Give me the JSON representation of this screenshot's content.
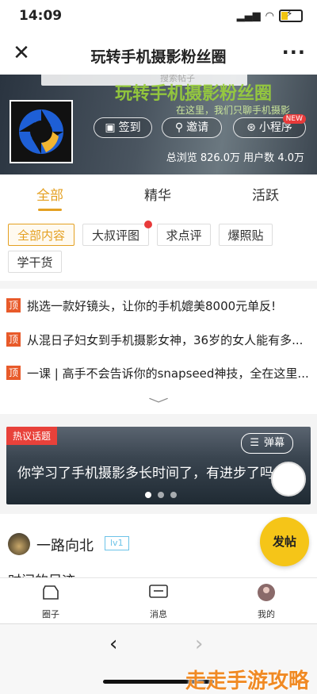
{
  "status_bar": {
    "time": "14:09"
  },
  "nav": {
    "title": "玩转手机摄影粉丝圈"
  },
  "banner": {
    "big_title": "玩转手机摄影粉丝圈",
    "slogan": "在这里，我们只聊手机摄影",
    "search_placeholder": "搜索帖子",
    "buttons": {
      "checkin": "签到",
      "invite": "邀请",
      "miniprogram": "小程序"
    },
    "new_badge": "NEW",
    "stats": "总浏览 826.0万  用户数 4.0万"
  },
  "tabs": [
    "全部",
    "精华",
    "活跃"
  ],
  "categories": [
    "全部内容",
    "大叔评图",
    "求点评",
    "爆照贴",
    "学干货"
  ],
  "pinned": {
    "tag": "顶",
    "items": [
      "挑选一款好镜头，让你的手机媲美8000元单反!",
      "从混日子妇女到手机摄影女神，36岁的女人能有多...",
      "一课 | 高手不会告诉你的snapseed神技，全在这里..."
    ]
  },
  "hot_topic": {
    "tag": "热议话题",
    "danmu": "弹幕",
    "text": "你学习了手机摄影多长时间了，有进步了吗"
  },
  "post": {
    "user": "一路向北",
    "level": "lv1",
    "title": "时间的足迹"
  },
  "fab": "发帖",
  "tabbar": [
    "圈子",
    "消息",
    "我的"
  ],
  "watermark": "走走手游攻略",
  "colors": {
    "accent": "#e4a021",
    "pin": "#e85a2a",
    "hot": "#e8413a",
    "fab": "#f5c518"
  }
}
